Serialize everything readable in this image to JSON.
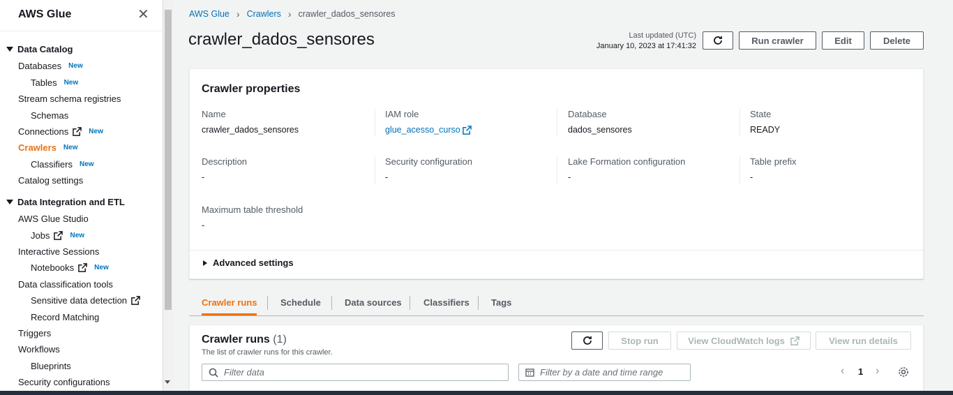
{
  "sidebar": {
    "title": "AWS Glue",
    "sections": [
      {
        "label": "Data Catalog"
      },
      {
        "label": "Data Integration and ETL"
      }
    ],
    "items": [
      {
        "label": "Databases",
        "badge": "New"
      },
      {
        "label": "Tables",
        "badge": "New"
      },
      {
        "label": "Stream schema registries"
      },
      {
        "label": "Schemas"
      },
      {
        "label": "Connections",
        "badge": "New"
      },
      {
        "label": "Crawlers",
        "badge": "New"
      },
      {
        "label": "Classifiers",
        "badge": "New"
      },
      {
        "label": "Catalog settings"
      },
      {
        "label": "AWS Glue Studio"
      },
      {
        "label": "Jobs",
        "badge": "New"
      },
      {
        "label": "Interactive Sessions"
      },
      {
        "label": "Notebooks",
        "badge": "New"
      },
      {
        "label": "Data classification tools"
      },
      {
        "label": "Sensitive data detection"
      },
      {
        "label": "Record Matching"
      },
      {
        "label": "Triggers"
      },
      {
        "label": "Workflows"
      },
      {
        "label": "Blueprints"
      },
      {
        "label": "Security configurations"
      }
    ]
  },
  "breadcrumb": [
    "AWS Glue",
    "Crawlers",
    "crawler_dados_sensores"
  ],
  "page": {
    "title": "crawler_dados_sensores",
    "last_updated_label": "Last updated (UTC)",
    "last_updated_value": "January 10, 2023 at 17:41:32",
    "buttons": {
      "run": "Run crawler",
      "edit": "Edit",
      "delete": "Delete"
    }
  },
  "properties": {
    "title": "Crawler properties",
    "fields": [
      {
        "label": "Name",
        "value": "crawler_dados_sensores"
      },
      {
        "label": "IAM role",
        "value": "glue_acesso_curso"
      },
      {
        "label": "Database",
        "value": "dados_sensores"
      },
      {
        "label": "State",
        "value": "READY"
      },
      {
        "label": "Description",
        "value": "-"
      },
      {
        "label": "Security configuration",
        "value": "-"
      },
      {
        "label": "Lake Formation configuration",
        "value": "-"
      },
      {
        "label": "Table prefix",
        "value": "-"
      },
      {
        "label": "Maximum table threshold",
        "value": "-"
      }
    ],
    "advanced": "Advanced settings"
  },
  "tabs": [
    "Crawler runs",
    "Schedule",
    "Data sources",
    "Classifiers",
    "Tags"
  ],
  "runs": {
    "title": "Crawler runs",
    "count": "(1)",
    "description": "The list of crawler runs for this crawler.",
    "buttons": {
      "stop": "Stop run",
      "logs": "View CloudWatch logs",
      "details": "View run details"
    },
    "filter_placeholder": "Filter data",
    "date_placeholder": "Filter by a date and time range",
    "page": "1"
  },
  "colors": {
    "accent": "#ec7211",
    "link": "#0073bb"
  }
}
